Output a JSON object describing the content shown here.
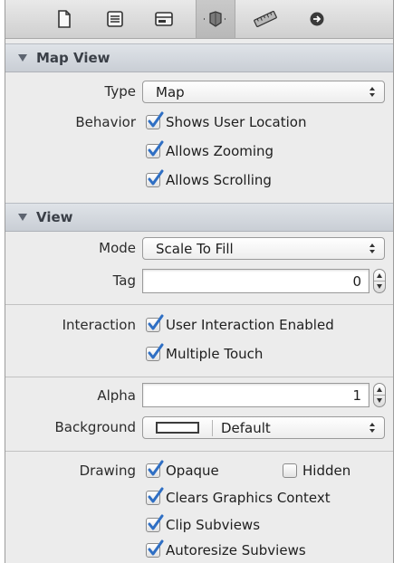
{
  "toolbar": {
    "tabs": [
      {
        "icon": "file-inspector-icon"
      },
      {
        "icon": "quick-help-icon"
      },
      {
        "icon": "identity-inspector-icon"
      },
      {
        "icon": "attributes-inspector-icon",
        "selected": true
      },
      {
        "icon": "size-inspector-icon"
      },
      {
        "icon": "connections-inspector-icon"
      }
    ]
  },
  "map_view": {
    "title": "Map View",
    "type_label": "Type",
    "type_value": "Map",
    "behavior_label": "Behavior",
    "shows_user_location": "Shows User Location",
    "allows_zooming": "Allows Zooming",
    "allows_scrolling": "Allows Scrolling"
  },
  "view": {
    "title": "View",
    "mode_label": "Mode",
    "mode_value": "Scale To Fill",
    "tag_label": "Tag",
    "tag_value": "0",
    "interaction_label": "Interaction",
    "user_interaction_enabled": "User Interaction Enabled",
    "multiple_touch": "Multiple Touch",
    "alpha_label": "Alpha",
    "alpha_value": "1",
    "background_label": "Background",
    "background_value": "Default",
    "drawing_label": "Drawing",
    "opaque": "Opaque",
    "hidden": "Hidden",
    "clears_graphics_context": "Clears Graphics Context",
    "clip_subviews": "Clip Subviews",
    "autoresize_subviews": "Autoresize Subviews"
  },
  "colors": {
    "checkmark": "#2f6fc4",
    "panel": "#ececec",
    "section_header": "#d5d9df"
  }
}
